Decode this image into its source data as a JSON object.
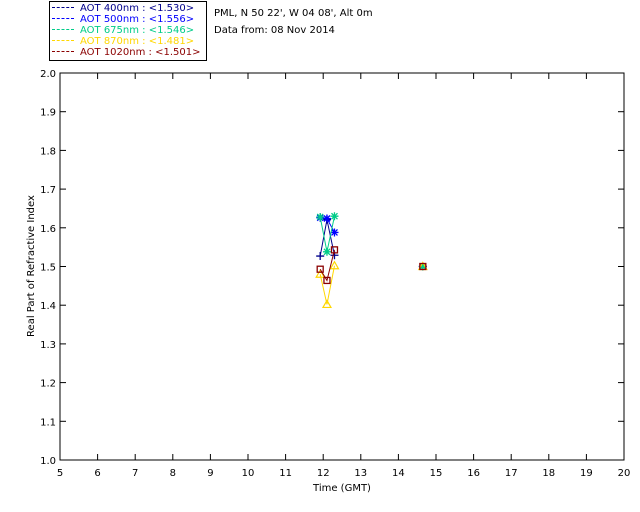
{
  "header": {
    "site": "PML, N 50 22', W 04 08', Alt 0m",
    "date": "Data from: 08 Nov 2014"
  },
  "legend": [
    {
      "label": "AOT  400nm : <1.530>",
      "color": "#00008b"
    },
    {
      "label": "AOT  500nm : <1.556>",
      "color": "#0000ff"
    },
    {
      "label": "AOT  675nm : <1.546>",
      "color": "#00cc88"
    },
    {
      "label": "AOT  870nm : <1.481>",
      "color": "#ffd700"
    },
    {
      "label": "AOT 1020nm : <1.501>",
      "color": "#8b0000"
    }
  ],
  "chart_data": {
    "type": "line",
    "title": "",
    "xlabel": "Time (GMT)",
    "ylabel": "Real Part of Refractive Index",
    "xlim": [
      5,
      20
    ],
    "ylim": [
      1.0,
      2.0
    ],
    "xticks": [
      5,
      6,
      7,
      8,
      9,
      10,
      11,
      12,
      13,
      14,
      15,
      16,
      17,
      18,
      19,
      20
    ],
    "yticks": [
      "1.0",
      "1.1",
      "1.2",
      "1.3",
      "1.4",
      "1.5",
      "1.6",
      "1.7",
      "1.8",
      "1.9",
      "2.0"
    ],
    "series": [
      {
        "color": "#00008b",
        "marker": "plus",
        "points": [
          [
            11.92,
            1.527
          ],
          [
            12.1,
            1.621
          ],
          [
            12.3,
            1.529
          ],
          [
            14.65,
            1.5
          ]
        ]
      },
      {
        "color": "#0000ff",
        "marker": "star",
        "points": [
          [
            11.92,
            1.626
          ],
          [
            12.1,
            1.624
          ],
          [
            12.3,
            1.588
          ],
          [
            14.65,
            1.5
          ]
        ]
      },
      {
        "color": "#00cc88",
        "marker": "star",
        "points": [
          [
            11.92,
            1.628
          ],
          [
            12.1,
            1.538
          ],
          [
            12.3,
            1.63
          ],
          [
            14.65,
            1.5
          ]
        ]
      },
      {
        "color": "#ffd700",
        "marker": "triangle",
        "points": [
          [
            11.92,
            1.48
          ],
          [
            12.1,
            1.402
          ],
          [
            12.3,
            1.502
          ],
          [
            14.65,
            1.5
          ]
        ]
      },
      {
        "color": "#8b0000",
        "marker": "square",
        "points": [
          [
            11.92,
            1.493
          ],
          [
            12.1,
            1.464
          ],
          [
            12.3,
            1.543
          ],
          [
            14.65,
            1.5
          ]
        ]
      }
    ]
  }
}
